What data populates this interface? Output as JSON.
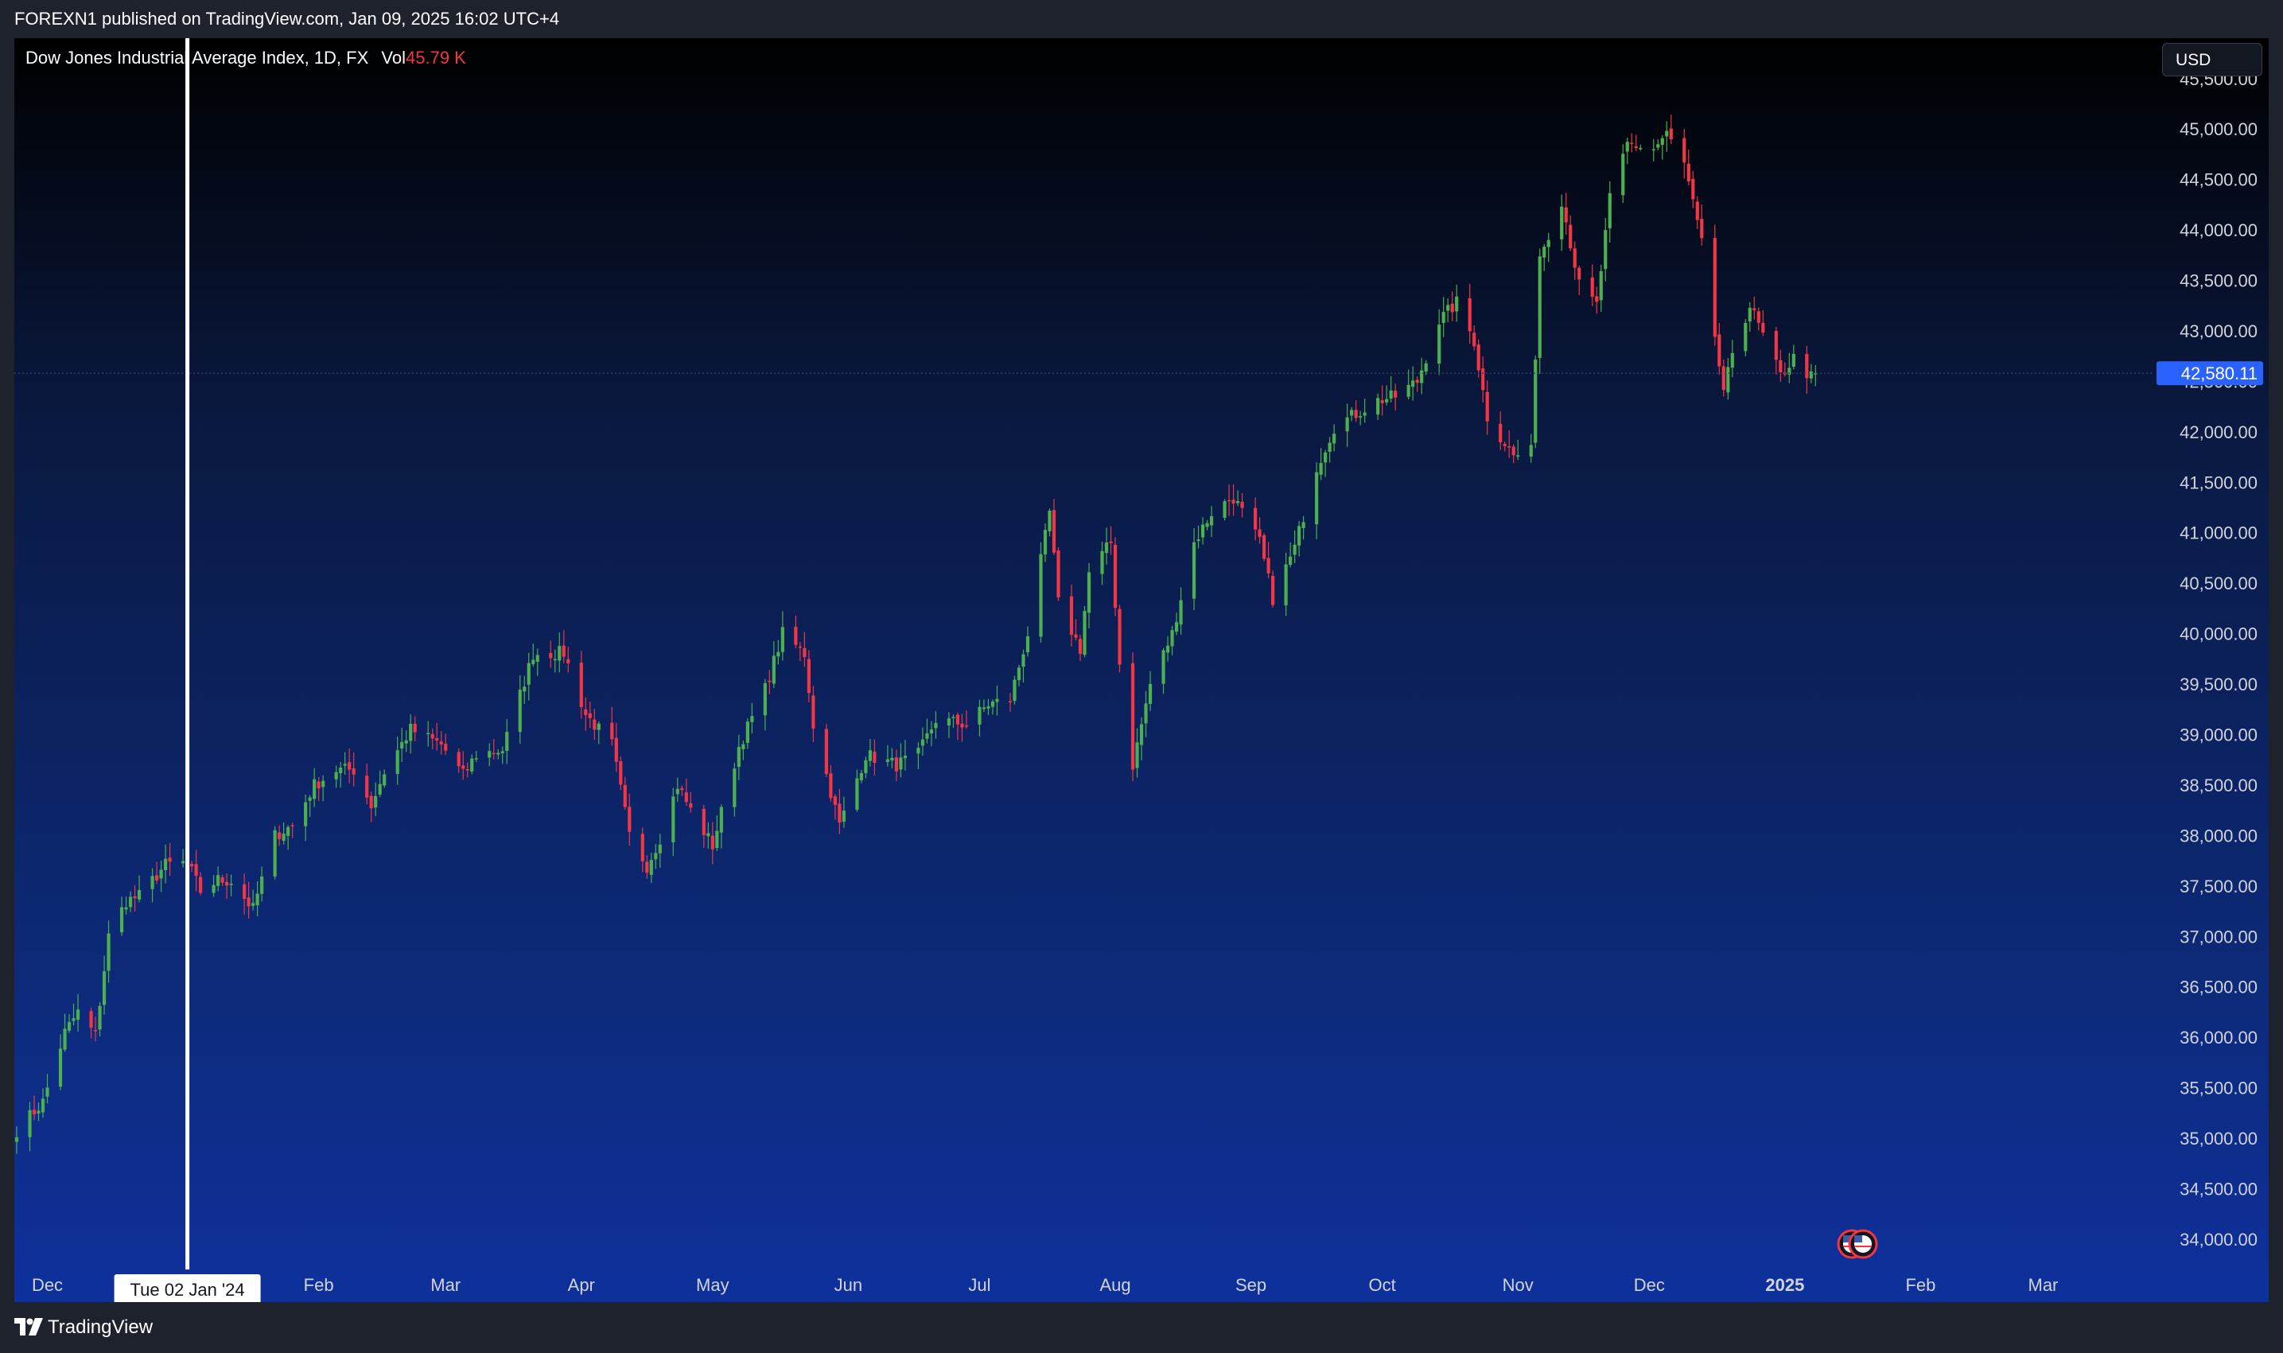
{
  "header": {
    "published": "FOREXN1 published on TradingView.com, Jan 09, 2025 16:02 UTC+4"
  },
  "legend": {
    "title": "Dow Jones Industrial Average Index, 1D, FX",
    "vol_label": "Vol",
    "vol_value": "45.79 K"
  },
  "currency": "USD",
  "crosshair": {
    "label": "Tue 02 Jan '24"
  },
  "last_price": {
    "label": "42,580.11"
  },
  "footer": {
    "brand": "TradingView"
  },
  "colors": {
    "up": "#4caf50",
    "down": "#f23645",
    "price_tag": "#2962ff"
  },
  "chart_data": {
    "type": "candlestick",
    "y_range": [
      33700,
      45900
    ],
    "x_range": [
      "2023-11-24",
      "2025-03-20"
    ],
    "y_ticks": [
      34000,
      34500,
      35000,
      35500,
      36000,
      36500,
      37000,
      37500,
      38000,
      38500,
      39000,
      39500,
      40000,
      40500,
      41000,
      41500,
      42000,
      42500,
      43000,
      43500,
      44000,
      44500,
      45000,
      45500
    ],
    "y_tick_labels": [
      "34,000.00",
      "34,500.00",
      "35,000.00",
      "35,500.00",
      "36,000.00",
      "36,500.00",
      "37,000.00",
      "37,500.00",
      "38,000.00",
      "38,500.00",
      "39,000.00",
      "39,500.00",
      "40,000.00",
      "40,500.00",
      "41,000.00",
      "41,500.00",
      "42,000.00",
      "42,500.00",
      "43,000.00",
      "43,500.00",
      "44,000.00",
      "44,500.00",
      "45,000.00",
      "45,500.00"
    ],
    "x_ticks": [
      {
        "date": "2023-12-01",
        "label": "Dec"
      },
      {
        "date": "2024-02-01",
        "label": "Feb"
      },
      {
        "date": "2024-03-01",
        "label": "Mar"
      },
      {
        "date": "2024-04-01",
        "label": "Apr"
      },
      {
        "date": "2024-05-01",
        "label": "May"
      },
      {
        "date": "2024-06-01",
        "label": "Jun"
      },
      {
        "date": "2024-07-01",
        "label": "Jul"
      },
      {
        "date": "2024-08-01",
        "label": "Aug"
      },
      {
        "date": "2024-09-01",
        "label": "Sep"
      },
      {
        "date": "2024-10-01",
        "label": "Oct"
      },
      {
        "date": "2024-11-01",
        "label": "Nov"
      },
      {
        "date": "2024-12-01",
        "label": "Dec"
      },
      {
        "date": "2025-01-01",
        "label": "2025"
      },
      {
        "date": "2025-02-01",
        "label": "Feb"
      },
      {
        "date": "2025-03-01",
        "label": "Mar"
      }
    ],
    "crosshair_date": "2024-01-02",
    "last_price": 42580.11,
    "anchors": [
      [
        "2023-11-24",
        35080
      ],
      [
        "2023-11-30",
        35360
      ],
      [
        "2023-12-05",
        36050
      ],
      [
        "2023-12-08",
        36250
      ],
      [
        "2023-12-12",
        36020
      ],
      [
        "2023-12-15",
        37000
      ],
      [
        "2023-12-19",
        37350
      ],
      [
        "2023-12-22",
        37400
      ],
      [
        "2023-12-28",
        37710
      ],
      [
        "2024-01-02",
        37730
      ],
      [
        "2024-01-05",
        37450
      ],
      [
        "2024-01-09",
        37560
      ],
      [
        "2024-01-12",
        37550
      ],
      [
        "2024-01-17",
        37270
      ],
      [
        "2024-01-22",
        38000
      ],
      [
        "2024-01-26",
        38100
      ],
      [
        "2024-01-31",
        38500
      ],
      [
        "2024-02-05",
        38650
      ],
      [
        "2024-02-09",
        38650
      ],
      [
        "2024-02-13",
        38300
      ],
      [
        "2024-02-16",
        38630
      ],
      [
        "2024-02-22",
        39050
      ],
      [
        "2024-02-29",
        38900
      ],
      [
        "2024-03-05",
        38600
      ],
      [
        "2024-03-08",
        38800
      ],
      [
        "2024-03-14",
        38850
      ],
      [
        "2024-03-21",
        39800
      ],
      [
        "2024-03-28",
        39810
      ],
      [
        "2024-04-02",
        39200
      ],
      [
        "2024-04-08",
        38900
      ],
      [
        "2024-04-12",
        38000
      ],
      [
        "2024-04-16",
        37700
      ],
      [
        "2024-04-19",
        37980
      ],
      [
        "2024-04-23",
        38500
      ],
      [
        "2024-04-26",
        38250
      ],
      [
        "2024-05-01",
        37900
      ],
      [
        "2024-05-07",
        38880
      ],
      [
        "2024-05-13",
        39450
      ],
      [
        "2024-05-17",
        40000
      ],
      [
        "2024-05-22",
        39800
      ],
      [
        "2024-05-24",
        39100
      ],
      [
        "2024-05-30",
        38100
      ],
      [
        "2024-06-05",
        38800
      ],
      [
        "2024-06-12",
        38700
      ],
      [
        "2024-06-17",
        38800
      ],
      [
        "2024-06-21",
        39150
      ],
      [
        "2024-06-28",
        39100
      ],
      [
        "2024-07-03",
        39300
      ],
      [
        "2024-07-08",
        39350
      ],
      [
        "2024-07-12",
        40000
      ],
      [
        "2024-07-17",
        41200
      ],
      [
        "2024-07-19",
        40300
      ],
      [
        "2024-07-24",
        39850
      ],
      [
        "2024-07-26",
        40600
      ],
      [
        "2024-07-31",
        40900
      ],
      [
        "2024-08-02",
        39700
      ],
      [
        "2024-08-05",
        38700
      ],
      [
        "2024-08-09",
        39500
      ],
      [
        "2024-08-14",
        40000
      ],
      [
        "2024-08-19",
        40900
      ],
      [
        "2024-08-23",
        41200
      ],
      [
        "2024-08-28",
        41350
      ],
      [
        "2024-09-03",
        40900
      ],
      [
        "2024-09-06",
        40350
      ],
      [
        "2024-09-11",
        40850
      ],
      [
        "2024-09-16",
        41650
      ],
      [
        "2024-09-20",
        42050
      ],
      [
        "2024-09-25",
        42180
      ],
      [
        "2024-09-30",
        42310
      ],
      [
        "2024-10-04",
        42350
      ],
      [
        "2024-10-09",
        42500
      ],
      [
        "2024-10-14",
        43100
      ],
      [
        "2024-10-18",
        43280
      ],
      [
        "2024-10-22",
        42900
      ],
      [
        "2024-10-25",
        42150
      ],
      [
        "2024-10-31",
        41760
      ],
      [
        "2024-11-04",
        41800
      ],
      [
        "2024-11-06",
        43750
      ],
      [
        "2024-11-11",
        44300
      ],
      [
        "2024-11-15",
        43450
      ],
      [
        "2024-11-19",
        43250
      ],
      [
        "2024-11-22",
        44300
      ],
      [
        "2024-11-26",
        44850
      ],
      [
        "2024-12-02",
        44800
      ],
      [
        "2024-12-05",
        44950
      ],
      [
        "2024-12-09",
        44650
      ],
      [
        "2024-12-13",
        43850
      ],
      [
        "2024-12-18",
        42350
      ],
      [
        "2024-12-20",
        42800
      ],
      [
        "2024-12-24",
        43250
      ],
      [
        "2024-12-27",
        42950
      ],
      [
        "2024-12-31",
        42550
      ],
      [
        "2025-01-03",
        42730
      ],
      [
        "2025-01-07",
        42540
      ],
      [
        "2025-01-08",
        42580
      ]
    ]
  }
}
